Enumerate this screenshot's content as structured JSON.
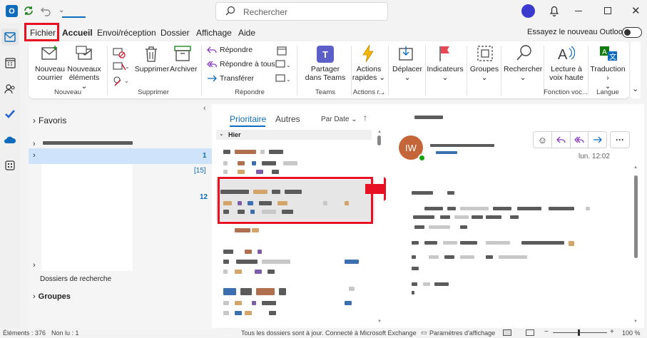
{
  "titlebar": {
    "search_placeholder": "Rechercher"
  },
  "menu": {
    "items": [
      "Fichier",
      "Accueil",
      "Envoi/réception",
      "Dossier",
      "Affichage",
      "Aide"
    ],
    "try_new": "Essayez le nouveau Outlook"
  },
  "ribbon": {
    "nouveau": {
      "new_mail": [
        "Nouveau",
        "courrier"
      ],
      "new_items": [
        "Nouveaux",
        "éléments"
      ],
      "group": "Nouveau"
    },
    "supprimer": {
      "delete": "Supprimer",
      "archive": "Archiver",
      "group": "Supprimer"
    },
    "repondre": {
      "reply": "Répondre",
      "reply_all": "Répondre à tous",
      "forward": "Transférer",
      "group": "Répondre"
    },
    "teams": {
      "share": [
        "Partager",
        "dans Teams"
      ],
      "group": "Teams"
    },
    "actions": {
      "quick": [
        "Actions",
        "rapides"
      ],
      "group": "Actions r..."
    },
    "deplacer": {
      "move": "Déplacer"
    },
    "indicateurs": {
      "flags": "Indicateurs"
    },
    "groupes": {
      "groups": "Groupes"
    },
    "rechercher": {
      "search": "Rechercher"
    },
    "fonction": {
      "read": [
        "Lecture à",
        "voix haute"
      ],
      "group": "Fonction voc..."
    },
    "langue": {
      "translate": "Traduction",
      "group": "Langue"
    }
  },
  "folders": {
    "favoris": "Favoris",
    "count1": "1",
    "count2": "[15]",
    "count3": "12",
    "search_folders": "Dossiers de recherche",
    "groups": "Groupes"
  },
  "list": {
    "tab_focused": "Prioritaire",
    "tab_other": "Autres",
    "sort": "Par Date",
    "section": "Hier"
  },
  "reading": {
    "avatar": "IW",
    "time": "lun. 12:02"
  },
  "status": {
    "items": "Éléments : 376",
    "unread": "Non lu : 1",
    "sync": "Tous les dossiers sont à jour.",
    "connected": "Connecté à Microsoft Exchange",
    "display": "Paramètres d'affichage",
    "zoom": "100 %"
  },
  "colors": {
    "accent": "#0f6cbd",
    "highlight": "#e81123",
    "avatar": "#c4663a",
    "presence": "#13a10e"
  }
}
